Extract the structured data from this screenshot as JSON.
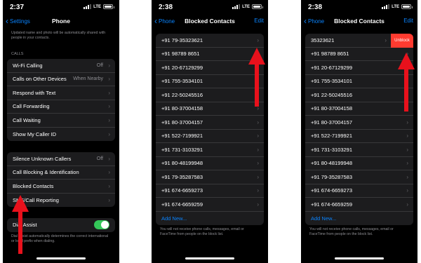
{
  "colors": {
    "accent": "#0a84ff",
    "arrow": "#e8111c",
    "toggle_on": "#34c759",
    "unblock": "#ff3b30"
  },
  "status": {
    "time1": "2:37",
    "time2": "2:38",
    "time3": "2:38",
    "network": "LTE"
  },
  "phone_settings": {
    "back_label": "Settings",
    "title": "Phone",
    "intro_note": "Updated name and photo will be automatically shared with people in your contacts.",
    "calls_header": "CALLS",
    "calls_items": [
      {
        "label": "Wi-Fi Calling",
        "value": "Off"
      },
      {
        "label": "Calls on Other Devices",
        "value": "When Nearby"
      },
      {
        "label": "Respond with Text",
        "value": ""
      },
      {
        "label": "Call Forwarding",
        "value": ""
      },
      {
        "label": "Call Waiting",
        "value": ""
      },
      {
        "label": "Show My Caller ID",
        "value": ""
      }
    ],
    "block_items": [
      {
        "label": "Silence Unknown Callers",
        "value": "Off"
      },
      {
        "label": "Call Blocking & Identification",
        "value": ""
      },
      {
        "label": "Blocked Contacts",
        "value": ""
      },
      {
        "label": "SMS/Call Reporting",
        "value": ""
      }
    ],
    "dial_assist_label": "Dial Assist",
    "dial_assist_on": true,
    "dial_assist_note": "Dial assist automatically determines the correct international or local prefix when dialing."
  },
  "blocked": {
    "back_label": "Phone",
    "title": "Blocked Contacts",
    "edit_label": "Edit",
    "numbers": [
      "+91 79-35323621",
      "+91 98789 8651",
      "+91 20-67129299",
      "+91 755-3534101",
      "+91 22-50245516",
      "+91 80-37004158",
      "+91 80-37004157",
      "+91 522-7199921",
      "+91 731-3103291",
      "+91 80-48199948",
      "+91 79-35287583",
      "+91 674-6659273",
      "+91 674-6659259"
    ],
    "add_new_label": "Add New...",
    "footer": "You will not receive phone calls, messages, email or FaceTime from people on the block list."
  },
  "blocked_swiped": {
    "first_number_partial": "35323621",
    "unblock_label": "Unblock"
  }
}
